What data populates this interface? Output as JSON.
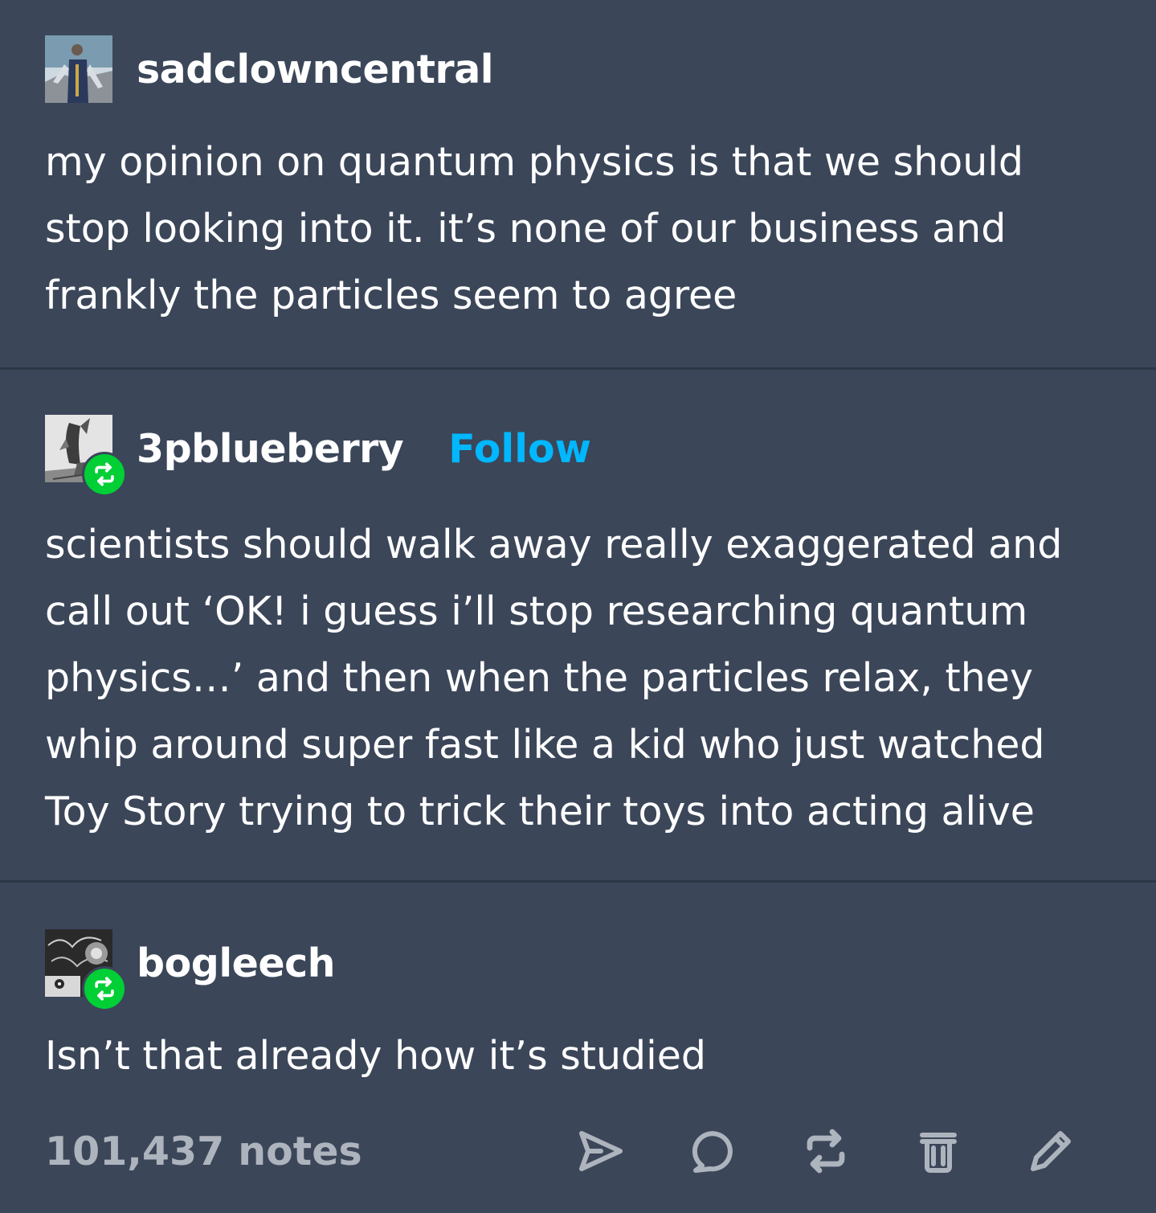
{
  "posts": [
    {
      "username": "sadclowncentral",
      "avatar_icon": "user-avatar",
      "text": "my opinion on quantum physics is that we should stop looking into it. it’s none of our business and frankly the particles seem to agree"
    },
    {
      "username": "3pblueberry",
      "follow_label": "Follow",
      "avatar_icon": "user-avatar",
      "badge_icon": "reblog-icon",
      "text": "scientists should walk away really exaggerated and call out ‘OK! i guess i’ll stop researching quantum physics…’ and then when the particles relax, they whip around super fast like a kid who just watched Toy Story trying to trick their toys into acting alive"
    },
    {
      "username": "bogleech",
      "avatar_icon": "user-avatar",
      "badge_icon": "reblog-icon",
      "text": "Isn’t that already how it’s studied"
    }
  ],
  "footer": {
    "notes": "101,437 notes",
    "actions": [
      "share-icon",
      "reply-icon",
      "reblog-icon",
      "delete-icon",
      "edit-icon"
    ]
  },
  "colors": {
    "background": "#3b4659",
    "divider": "#2c3645",
    "text": "#ffffff",
    "notes": "#aeb4bd",
    "follow": "#00b8ff",
    "reblog_badge": "#00cf35"
  }
}
